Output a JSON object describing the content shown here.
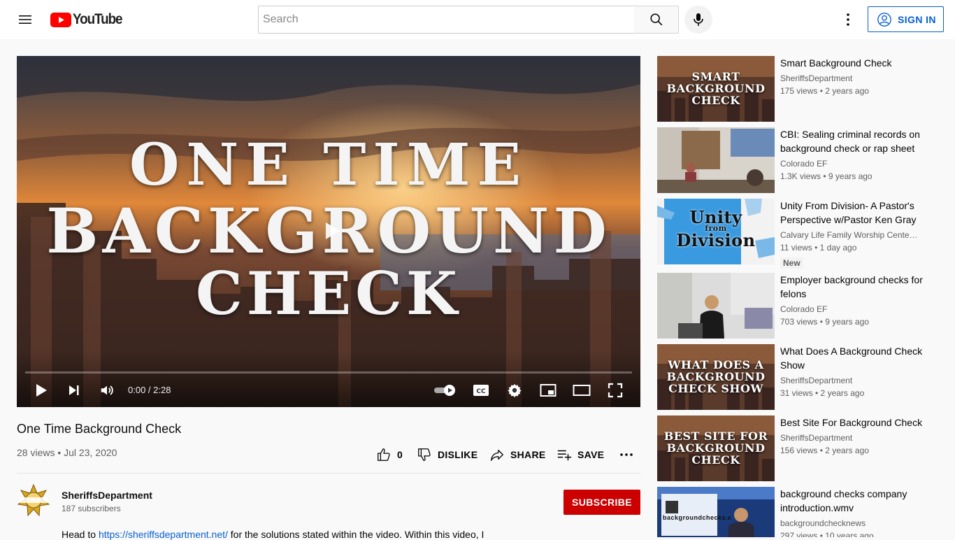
{
  "header": {
    "logo_text": "YouTube",
    "search_placeholder": "Search",
    "signin_label": "SIGN IN"
  },
  "player": {
    "thumbnail_lines": [
      "ONE TIME",
      "BACKGROUND",
      "CHECK"
    ],
    "time_display": "0:00 / 2:28",
    "progress_fraction": 0.0
  },
  "video": {
    "title": "One Time Background Check",
    "meta": "28 views • Jul 23, 2020",
    "like_count": "0",
    "dislike_label": "DISLIKE",
    "share_label": "SHARE",
    "save_label": "SAVE"
  },
  "channel": {
    "name": "SheriffsDepartment",
    "subscribers": "187 subscribers",
    "subscribe_label": "SUBSCRIBE",
    "avatar_text": "SHERIFFS DEPARTMENT"
  },
  "description": {
    "prefix": "Head to ",
    "link": "https://sheriffsdepartment.net/",
    "suffix": " for the solutions stated within the video. Within this video, I"
  },
  "recommendations": [
    {
      "title": "Smart Background Check",
      "channel": "SheriffsDepartment",
      "meta": "175 views • 2 years ago",
      "thumb_text": [
        "SMART",
        "BACKGROUND",
        "CHECK"
      ]
    },
    {
      "title": "CBI: Sealing criminal records on background check or rap sheet",
      "channel": "Colorado EF",
      "meta": "1.3K views • 9 years ago"
    },
    {
      "title": "Unity From Division- A Pastor's Perspective w/Pastor Ken Gray",
      "channel": "Calvary Life Family Worship Center ...",
      "meta": "11 views • 1 day ago",
      "badge": "New",
      "thumb_text": [
        "Unity",
        "from",
        "Division"
      ]
    },
    {
      "title": "Employer background checks for felons",
      "channel": "Colorado EF",
      "meta": "703 views • 9 years ago"
    },
    {
      "title": "What Does A Background Check Show",
      "channel": "SheriffsDepartment",
      "meta": "31 views • 2 years ago",
      "thumb_text": [
        "WHAT DOES A",
        "BACKGROUND",
        "CHECK SHOW"
      ]
    },
    {
      "title": "Best Site For Background Check",
      "channel": "SheriffsDepartment",
      "meta": "156 views • 2 years ago",
      "thumb_text": [
        "BEST SITE FOR",
        "BACKGROUND",
        "CHECK"
      ]
    },
    {
      "title": "background checks company introduction.wmv",
      "channel": "backgroundchecknews",
      "meta": "297 views • 10 years ago",
      "thumb_text": [
        "backgroundchecks.c"
      ]
    }
  ],
  "colors": {
    "brand_red": "#ff0000",
    "subscribe_red": "#cc0000",
    "link_blue": "#065fd4"
  }
}
